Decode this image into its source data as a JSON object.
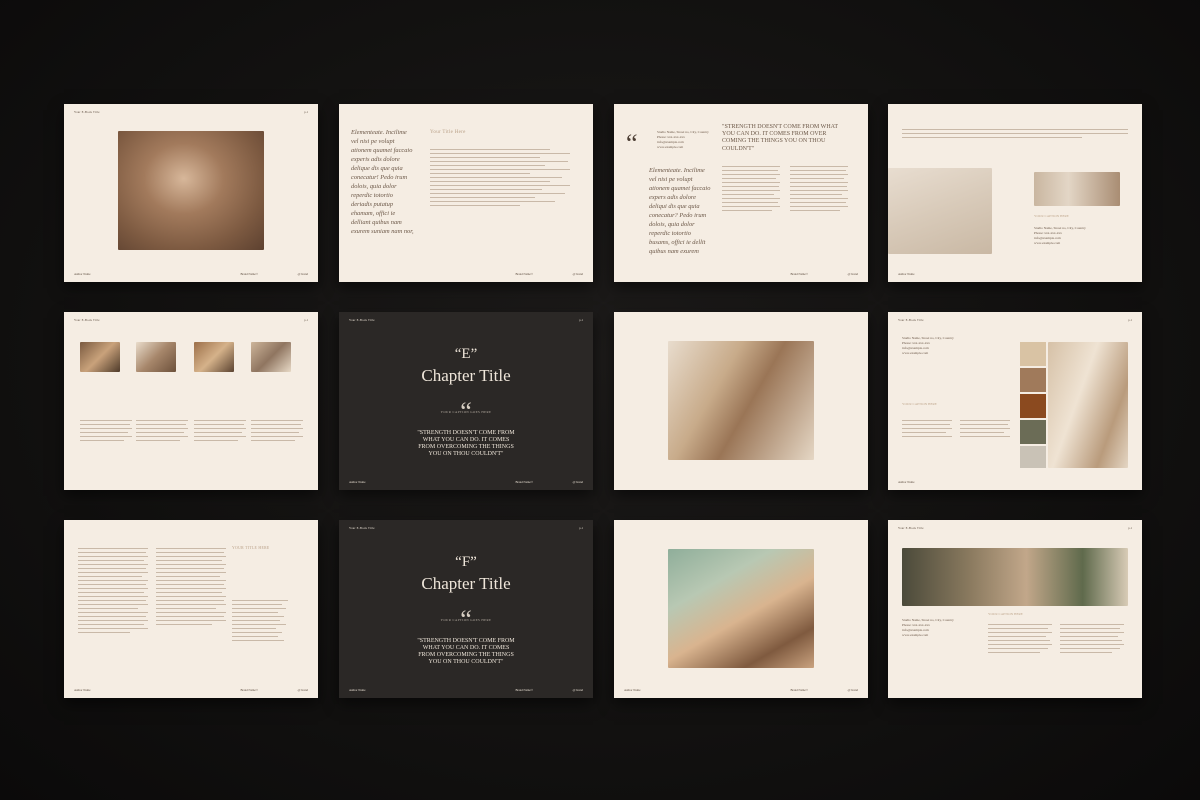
{
  "common": {
    "book_title": "Your E-Book Title",
    "page_num": "p.1",
    "author": "Author Name",
    "brand": "Brand Name®",
    "handle": "@ brand"
  },
  "slide2": {
    "italic_text": "Elementeate. Incilime vel nisi pe volupt ationem quamet faccaio experis adis dolore delique dis que quia conecatur! Pedo irum dolois, quia dolor reperdic totortio deriadis putatup ehamam, offici ie delliant quibus nam exurem suniam nam nor, rat.",
    "title": "Your Title Here"
  },
  "slide3": {
    "quote": "\"STRENGTH DOESN'T COME FROM WHAT YOU CAN DO. IT COMES FROM OVER COMING THE THINGS YOU ON THOU COULDN'T\"",
    "contact": "Studio Name, Street no, City, Country\nPhone: xxx-xxx-xxx\ninfo@example.com\nwww.example.com",
    "italic_text": "Elementeate. Incilime vel nisi pe volupt ationem quamet faccaio expers adis dolore deliqui dis que quia conecatur? Pedo irum dolois, quia dolor reperdic totortio busams, offici ie dellit quibus nam exurem senitem."
  },
  "slide4": {
    "caption": "YOUR CAPTION HERE",
    "contact": "Studio Name, Street no, City, Country\nPhone: xxx-xxx-xxx\ninfo@example.com\nwww.example.com"
  },
  "chapters": [
    {
      "letter": "“E”",
      "title": "Chapter Title",
      "sub": "YOUR CAPTION GOES HERE",
      "quote": "\"STRENGTH DOESN'T COME FROM WHAT YOU CAN DO. IT COMES FROM OVERCOMING THE THINGS YOU ON THOU COULDN'T\""
    },
    {
      "letter": "“F”",
      "title": "Chapter Title",
      "sub": "YOUR CAPTION GOES HERE",
      "quote": "\"STRENGTH DOESN'T COME FROM WHAT YOU CAN DO. IT COMES FROM OVERCOMING THE THINGS YOU ON THOU COULDN'T\""
    }
  ],
  "slide8": {
    "contact": "Studio Name, Street no, City, Country\nPhone: xxx-xxx-xxx\ninfo@example.com\nwww.example.com",
    "caption": "YOUR CAPTION HERE"
  },
  "slide9": {
    "title": "YOUR TITLE HERE"
  },
  "slide12": {
    "contact": "Studio Name, Street no, City, Country\nPhone: xxx-xxx-xxx\ninfo@example.com\nwww.example.com",
    "caption": "YOUR CAPTION HERE"
  },
  "colors": {
    "swatches": [
      "#d9c3a4",
      "#a07a5b",
      "#8b4a1f",
      "#6b6c56",
      "#c9c2b6"
    ]
  }
}
